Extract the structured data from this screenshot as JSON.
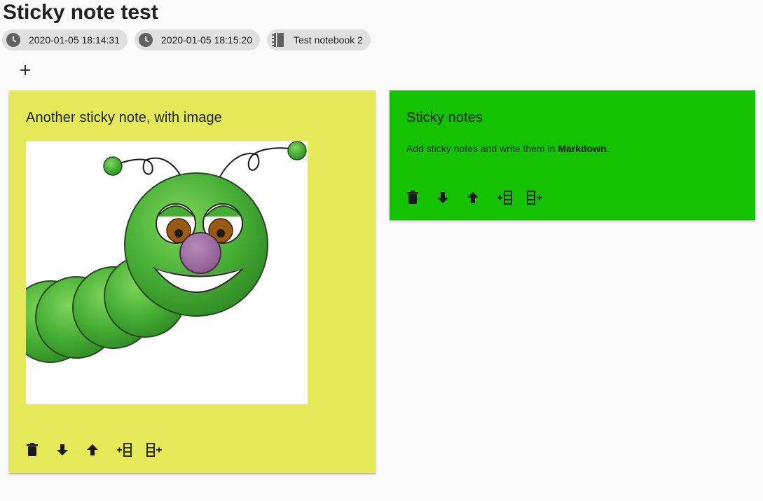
{
  "page": {
    "title": "Sticky note test"
  },
  "chips": [
    {
      "icon": "clock-icon",
      "label": "2020-01-05 18:14:31"
    },
    {
      "icon": "clock-icon",
      "label": "2020-01-05 18:15:20"
    },
    {
      "icon": "notebook-icon",
      "label": "Test notebook 2"
    }
  ],
  "toolbar": {
    "add_icon": "plus-icon"
  },
  "notes": [
    {
      "color": "#e6e957",
      "title": "Another sticky note, with image",
      "image": "caterpillar-illustration"
    },
    {
      "color": "#13c200",
      "title": "Sticky notes",
      "text_before": "Add sticky notes and write them in ",
      "text_bold": "Markdown",
      "text_after": "."
    }
  ],
  "note_actions": [
    {
      "icon": "delete-icon"
    },
    {
      "icon": "move-down-icon"
    },
    {
      "icon": "move-up-icon"
    },
    {
      "icon": "insert-before-icon"
    },
    {
      "icon": "insert-after-icon"
    }
  ],
  "colors": {
    "background": "#fafafa",
    "chip": "#e0e0e0",
    "yellow_note": "#e6e957",
    "green_note": "#13c200"
  }
}
